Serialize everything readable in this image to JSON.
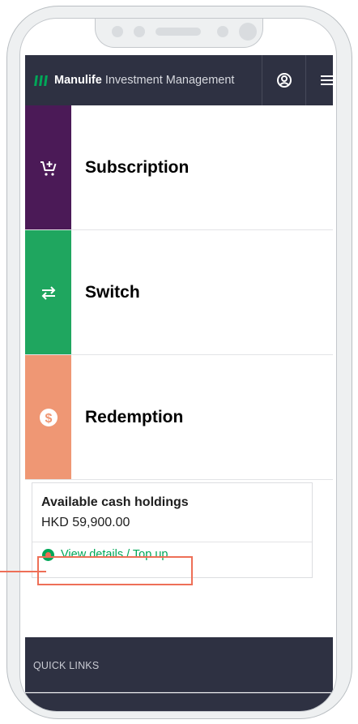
{
  "header": {
    "brand": "Manulife",
    "brand_rest": " Investment Management",
    "profile_icon": "user-circle-icon",
    "menu_icon": "hamburger-menu-icon"
  },
  "actions": [
    {
      "label": "Subscription",
      "icon": "cart-plus-icon",
      "color": "#4b1a57"
    },
    {
      "label": "Switch",
      "icon": "switch-arrows-icon",
      "color": "#1fa65f"
    },
    {
      "label": "Redemption",
      "icon": "dollar-circle-icon",
      "color": "#ef9774"
    }
  ],
  "cash": {
    "title": "Available cash holdings",
    "amount": "HKD 59,900.00",
    "link_label": "View details / Top up"
  },
  "footer": {
    "quick_links": "QUICK LINKS"
  },
  "colors": {
    "header_bg": "#2e3142",
    "accent_green": "#00a758",
    "highlight": "#ee6f57"
  }
}
